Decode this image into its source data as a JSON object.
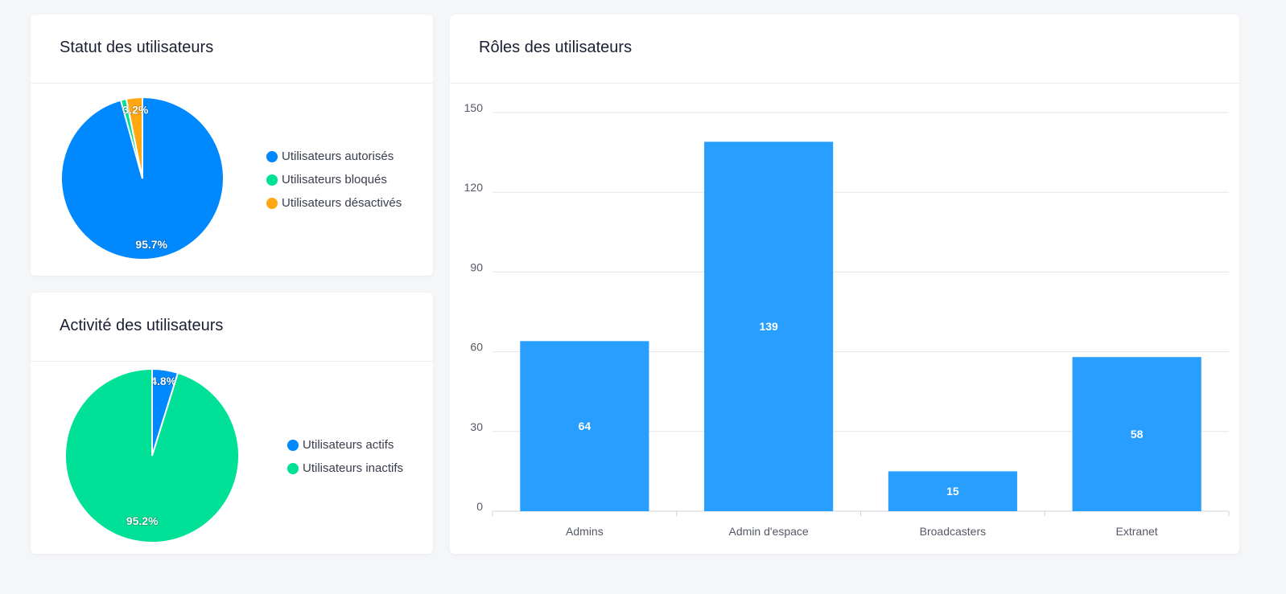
{
  "colors": {
    "blue": "#0088fe",
    "green": "#00e096",
    "orange": "#ffa813",
    "bar": "#289efe"
  },
  "chart_data": [
    {
      "type": "pie",
      "title": "Statut des utilisateurs",
      "slices": [
        {
          "name": "Utilisateurs autorisés",
          "value": 95.7,
          "label": "95.7%",
          "color": "#0088fe"
        },
        {
          "name": "Utilisateurs bloqués",
          "value": 1.1,
          "label": "",
          "color": "#00e096"
        },
        {
          "name": "Utilisateurs désactivés",
          "value": 3.2,
          "label": "3.2%",
          "color": "#ffa813"
        }
      ],
      "legend": "right"
    },
    {
      "type": "pie",
      "title": "Activité des utilisateurs",
      "slices": [
        {
          "name": "Utilisateurs actifs",
          "value": 4.8,
          "label": "4.8%",
          "color": "#0088fe"
        },
        {
          "name": "Utilisateurs inactifs",
          "value": 95.2,
          "label": "95.2%",
          "color": "#00e096"
        }
      ],
      "legend": "right"
    },
    {
      "type": "bar",
      "title": "Rôles des utilisateurs",
      "categories": [
        "Admins",
        "Admin d'espace",
        "Broadcasters",
        "Extranet"
      ],
      "values": [
        64,
        139,
        15,
        58
      ],
      "value_labels": [
        "64",
        "139",
        "15",
        "58"
      ],
      "yticks": [
        "0",
        "30",
        "60",
        "90",
        "120",
        "150"
      ],
      "ylim": [
        0,
        150
      ],
      "grid": true,
      "xlabel": "",
      "ylabel": ""
    }
  ]
}
